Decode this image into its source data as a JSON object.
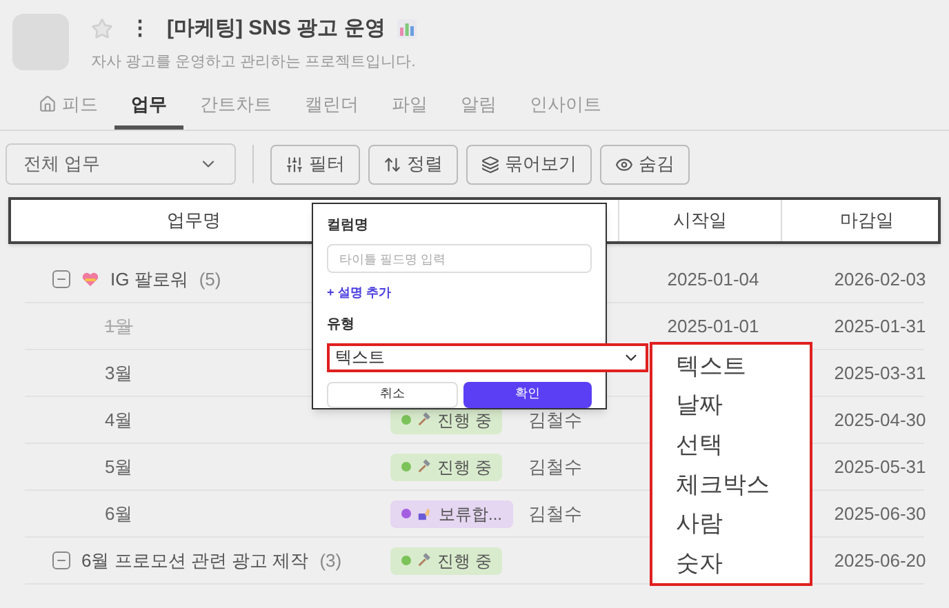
{
  "project": {
    "title": "[마케팅] SNS 광고 운영",
    "more": "⋮",
    "description": "자사 광고를 운영하고 관리하는 프로젝트입니다.",
    "starred": false
  },
  "tabs": [
    {
      "label": "피드",
      "kind": "home",
      "selected": false
    },
    {
      "label": "업무",
      "selected": true
    },
    {
      "label": "간트차트",
      "selected": false
    },
    {
      "label": "캘린더",
      "selected": false
    },
    {
      "label": "파일",
      "selected": false
    },
    {
      "label": "알림",
      "selected": false
    },
    {
      "label": "인사이트",
      "selected": false
    }
  ],
  "toolbar": {
    "view_select": "전체 업무",
    "buttons": [
      {
        "label": "필터",
        "kind": "filter"
      },
      {
        "label": "정렬",
        "kind": "sort"
      },
      {
        "label": "묶어보기",
        "kind": "group"
      },
      {
        "label": "숨김",
        "kind": "hide"
      }
    ]
  },
  "table": {
    "columns": [
      "업무명",
      "시작일",
      "마감일"
    ],
    "rows": [
      {
        "kind": "group",
        "name": "IG 팔로워",
        "count": "(5)",
        "start": "2025-01-04",
        "due": "2026-02-03"
      },
      {
        "kind": "task",
        "name": "1월",
        "done": true,
        "start": "2025-01-01",
        "due": "2025-01-31"
      },
      {
        "kind": "task",
        "name": "3월",
        "done": false,
        "due": "2025-03-31"
      },
      {
        "kind": "task",
        "name": "4월",
        "done": false,
        "status": {
          "label": "진행 중",
          "kind": "progress",
          "color": "#7cc35a"
        },
        "assignee": "김철수",
        "due": "2025-04-30"
      },
      {
        "kind": "task",
        "name": "5월",
        "done": false,
        "status": {
          "label": "진행 중",
          "kind": "progress",
          "color": "#7cc35a"
        },
        "assignee": "김철수",
        "due": "2025-05-31"
      },
      {
        "kind": "task",
        "name": "6월",
        "done": false,
        "status": {
          "label": "보류합...",
          "kind": "hold",
          "color": "#a45fe0"
        },
        "assignee": "김철수",
        "due": "2025-06-30"
      },
      {
        "kind": "group",
        "name": "6월 프로모션 관련 광고 제작",
        "count": "(3)",
        "status": {
          "label": "진행 중",
          "kind": "progress",
          "color": "#7cc35a"
        },
        "due": "2025-06-20"
      }
    ]
  },
  "column_popup": {
    "name_label": "컬럼명",
    "name_placeholder": "타이틀 필드명 입력",
    "add_description": "+ 설명 추가",
    "type_label": "유형",
    "type_value": "텍스트",
    "cancel": "취소",
    "confirm": "확인"
  },
  "type_options": [
    "텍스트",
    "날짜",
    "선택",
    "체크박스",
    "사람",
    "숫자"
  ]
}
